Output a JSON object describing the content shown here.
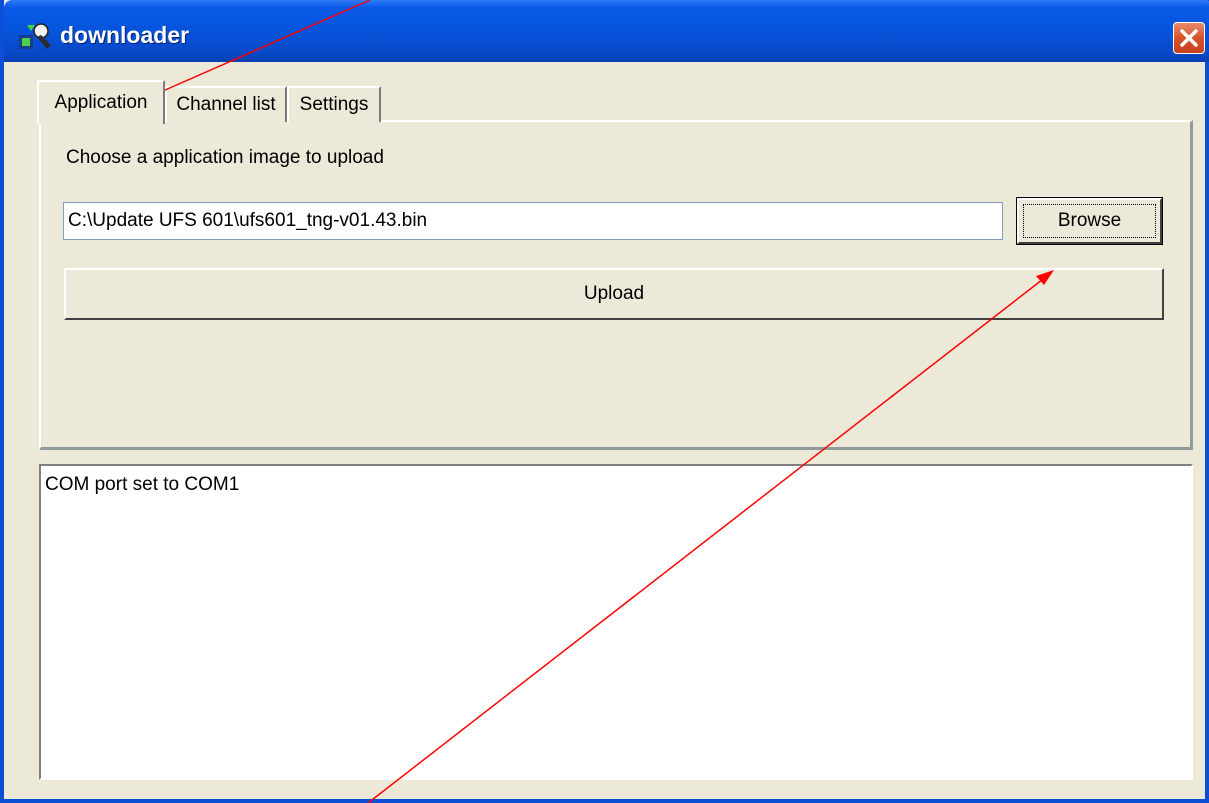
{
  "window": {
    "title": "downloader",
    "icon": "downloader-app-icon",
    "close_icon": "close-icon"
  },
  "tabs": [
    {
      "label": "Application",
      "active": true
    },
    {
      "label": "Channel list",
      "active": false
    },
    {
      "label": "Settings",
      "active": false
    }
  ],
  "application_tab": {
    "prompt_label": "Choose a application image to upload",
    "file_path_value": "C:\\Update UFS 601\\ufs601_tng-v01.43.bin",
    "browse_label": "Browse",
    "upload_label": "Upload"
  },
  "log": {
    "lines": [
      "COM port set to COM1"
    ]
  },
  "annotations": {
    "arrow_color": "#ff0000"
  },
  "colors": {
    "titlebar": "#0654db",
    "window_face": "#ece9d8",
    "close_button": "#d7542b"
  }
}
